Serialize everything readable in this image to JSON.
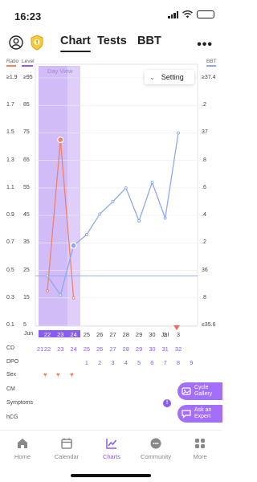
{
  "status_bar": {
    "time": "16:23"
  },
  "nav": {
    "tabs": [
      "Chart",
      "Tests",
      "BBT"
    ],
    "active_tab": "Chart"
  },
  "chart": {
    "left_axis_title_1": "Ratio",
    "left_axis_title_2": "Level",
    "right_axis_title": "BBT",
    "day_view_label": "Day View",
    "setting_label": "Setting",
    "ratio_ticks": [
      "≥1.9",
      "1.7",
      "1.5",
      "1.3",
      "1.1",
      "0.9",
      "0.7",
      "0.5",
      "0.3",
      "0.1"
    ],
    "level_ticks": [
      "≥95",
      "85",
      "75",
      "65",
      "55",
      "45",
      "35",
      "25",
      "15",
      "5"
    ],
    "bbt_ticks": [
      "≥37.4",
      ".2",
      "37",
      ".8",
      ".6",
      ".4",
      ".2",
      "36",
      ".8",
      "≤35.6"
    ],
    "colors": {
      "lh_series": "#f08066",
      "bbt_series": "#8fa8f0",
      "accent": "#8a5cf5",
      "highlight": "#c9b0f7"
    }
  },
  "chart_data": {
    "type": "line",
    "x": [
      "22",
      "23",
      "24",
      "25",
      "26",
      "27",
      "28",
      "29",
      "30",
      "2",
      "3"
    ],
    "series": [
      {
        "name": "Ratio",
        "values": [
          0.35,
          1.45,
          0.3,
          null,
          null,
          null,
          null,
          null,
          null,
          null,
          null
        ]
      },
      {
        "name": "BBT",
        "values": [
          35.96,
          35.82,
          36.18,
          36.26,
          36.41,
          36.5,
          36.6,
          36.36,
          36.64,
          36.38,
          37.0
        ]
      }
    ],
    "baseline_bbt": 35.96,
    "ylim_ratio": [
      0.1,
      1.9
    ],
    "ylim_level": [
      5,
      95
    ],
    "ylim_bbt": [
      35.6,
      37.4
    ],
    "highlight_range": [
      "22",
      "24"
    ]
  },
  "table": {
    "months": {
      "jun": "Jun",
      "jul": "Jul"
    },
    "dates": [
      "22",
      "23",
      "24",
      "25",
      "26",
      "27",
      "28",
      "29",
      "30",
      "2",
      "3"
    ],
    "rows": {
      "cd_label": "CD",
      "cd": [
        "21",
        "22",
        "23",
        "24",
        "25",
        "26",
        "27",
        "28",
        "29",
        "30",
        "31",
        "32"
      ],
      "dpo_label": "DPO",
      "dpo": [
        "1",
        "2",
        "3",
        "4",
        "5",
        "6",
        "7",
        "8",
        "9"
      ],
      "sex_label": "Sex",
      "cm_label": "CM",
      "symptoms_label": "Symptoms",
      "hcg_label": "hCG"
    }
  },
  "floating": {
    "cycle_gallery": "Cycle Gallery",
    "ask_expert": "Ask an Expert"
  },
  "bottom_nav": [
    {
      "label": "Home"
    },
    {
      "label": "Calendar"
    },
    {
      "label": "Charts"
    },
    {
      "label": "Community"
    },
    {
      "label": "More"
    }
  ]
}
